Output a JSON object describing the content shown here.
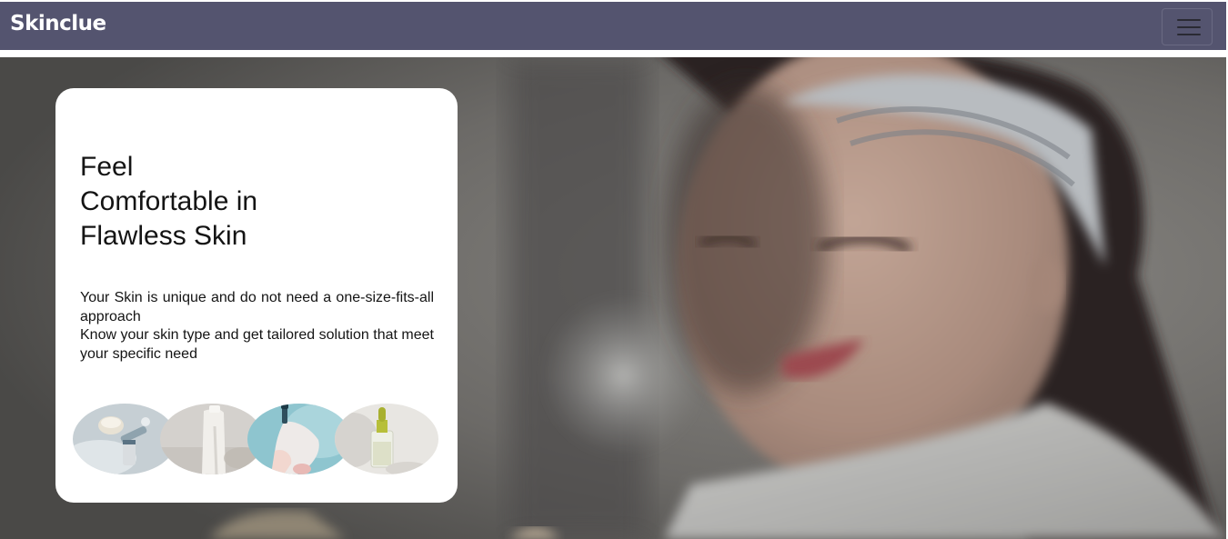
{
  "navbar": {
    "brand": "Skinclue",
    "toggler_icon": "hamburger-menu-icon"
  },
  "hero": {
    "background_image": "woman-with-headband-smiling-photo",
    "card": {
      "headline_lines": [
        "Feel",
        "Comfortable in",
        "Flawless Skin"
      ],
      "description_lines": [
        "Your Skin is unique and do not need a one-size-fits-all approach",
        "Know your skin type and get tailored solution that meet your specific need"
      ],
      "thumbnails": [
        "skincare-cream-jar-photo",
        "white-lotion-bottle-photo",
        "serum-dropper-hand-photo",
        "oil-bottle-dropper-photo"
      ]
    }
  },
  "colors": {
    "navbar_bg": "#54546f",
    "brand_text": "#ffffff",
    "card_bg": "#ffffff",
    "text": "#141414"
  }
}
